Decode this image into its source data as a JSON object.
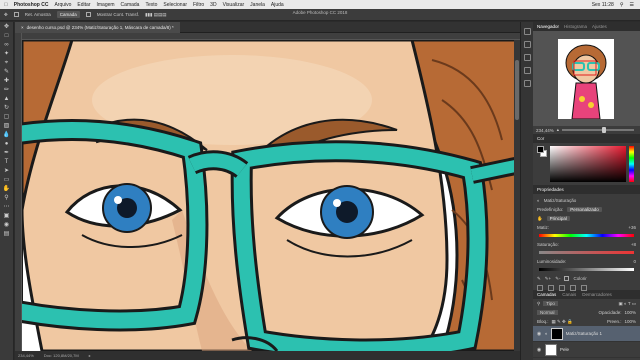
{
  "menubar": {
    "app": "Photoshop CC",
    "items": [
      "Arquivo",
      "Editar",
      "Imagem",
      "Camada",
      "Texto",
      "Selecionar",
      "Filtro",
      "3D",
      "Visualizar",
      "Janela",
      "Ajuda"
    ],
    "clock": "Sex 11:28"
  },
  "window_title": "Adobe Photoshop CC 2018",
  "options": {
    "sample_label": "Ret. Amostra",
    "sample_value": "Camada",
    "show_ring": "Mostrar Cont. Transf."
  },
  "document": {
    "tab": "desenho curso.psd @ 234% (Matiz/Saturação 1, Máscara de camada/8) *"
  },
  "status": {
    "zoom": "234,44%",
    "doc": "Doc: 120,8M/20,7M"
  },
  "panels": {
    "navigator_tabs": [
      "Navegador",
      "Histograma",
      "Ajustes"
    ],
    "zoom": "234,44%",
    "color_title": "Cor",
    "properties_title": "Propriedades",
    "properties_sub": "Matiz/Saturação",
    "preset_label": "Predefinição:",
    "preset_value": "Personalizado",
    "channel_value": "Principal",
    "hue_label": "Matiz:",
    "hue_value": "+36",
    "saturation_label": "Saturação:",
    "saturation_value": "+8",
    "lightness_label": "Luminosidade:",
    "lightness_value": "0",
    "colorize": "Colorir",
    "layers_tabs": [
      "Camadas",
      "Canais",
      "Demarcadores"
    ],
    "kind": "Tipo",
    "blend": "Normal",
    "opacity_label": "Opacidade:",
    "opacity_value": "100%",
    "lock_label": "Bloq.:",
    "fill_label": "Preen.:",
    "fill_value": "100%",
    "layers": [
      {
        "name": "Matiz/Saturação 1"
      },
      {
        "name": "Pele"
      }
    ]
  }
}
